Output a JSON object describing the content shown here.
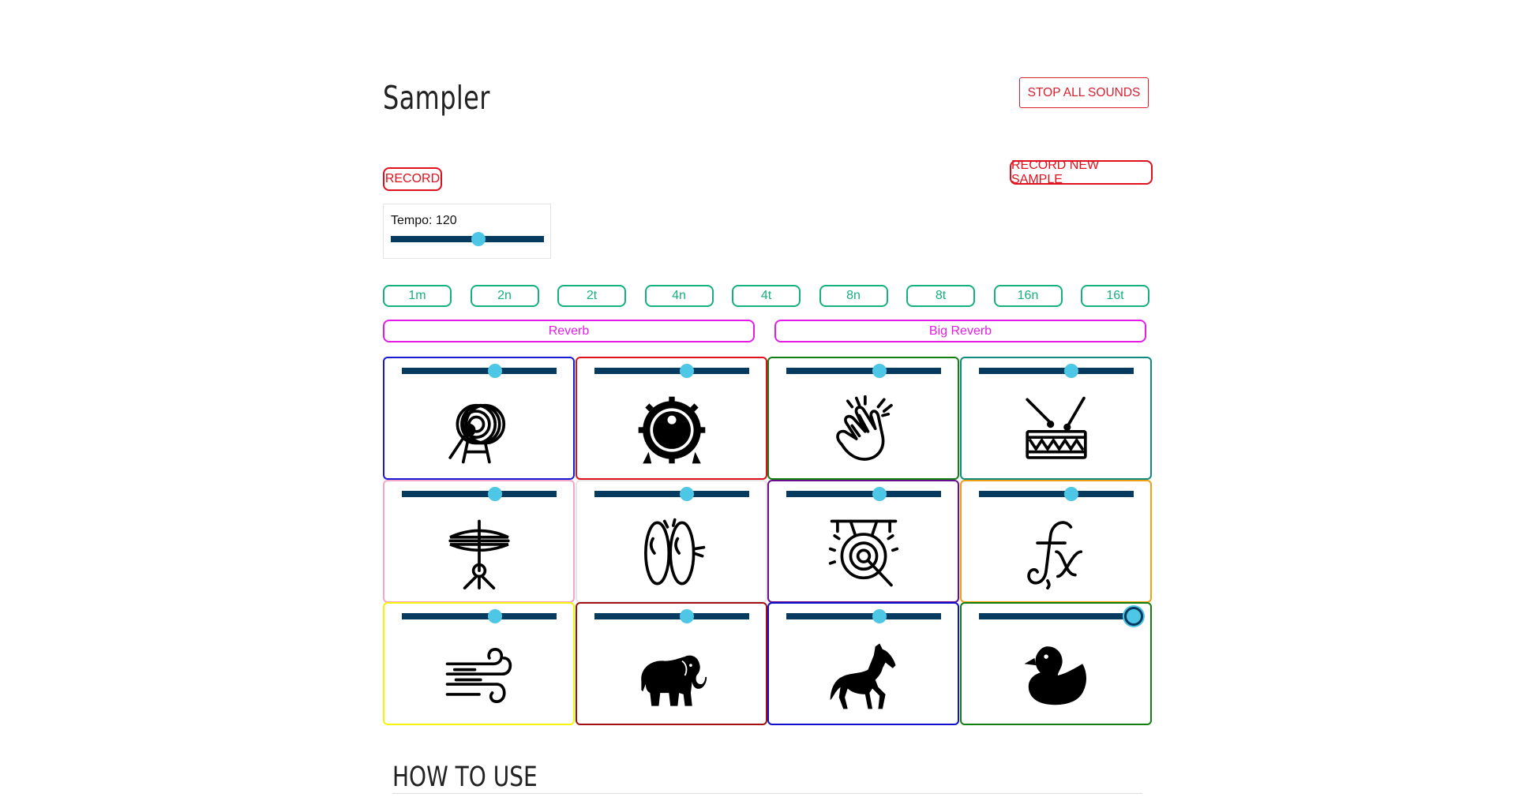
{
  "header": {
    "title": "Sampler",
    "stop_label": "STOP ALL SOUNDS"
  },
  "controls": {
    "record_label": "RECORD",
    "record_new_label": "RECORD NEW SAMPLE",
    "tempo_label": "Tempo: 120",
    "tempo_level": 0.57
  },
  "notes": [
    "1m",
    "2n",
    "2t",
    "4n",
    "4t",
    "8n",
    "8t",
    "16n",
    "16t"
  ],
  "effects": [
    "Reverb",
    "Big Reverb"
  ],
  "colors": {
    "accent_red": "#e0101d",
    "note_green": "#15b07c",
    "effect_magenta": "#e61ce6",
    "slider_track": "#063a5e",
    "slider_thumb": "#4ec7e6"
  },
  "pads": [
    {
      "icon": "bass-drum-icon",
      "border": "#1a1ad6",
      "volume": 0.6
    },
    {
      "icon": "drum-head-icon",
      "border": "#e0101d",
      "volume": 0.6
    },
    {
      "icon": "clap-icon",
      "border": "#118011",
      "volume": 0.6
    },
    {
      "icon": "snare-drum-icon",
      "border": "#0e8a80",
      "volume": 0.6
    },
    {
      "icon": "hi-hat-icon",
      "border": "#f6a5c8",
      "volume": 0.6
    },
    {
      "icon": "cymbals-icon",
      "border": "#e6e6e6",
      "volume": 0.6
    },
    {
      "icon": "gong-icon",
      "border": "#6a0d91",
      "volume": 0.6
    },
    {
      "icon": "fx-icon",
      "border": "#f0a010",
      "volume": 0.6
    },
    {
      "icon": "wind-icon",
      "border": "#f5f50a",
      "volume": 0.6
    },
    {
      "icon": "elephant-icon",
      "border": "#a01010",
      "volume": 0.6
    },
    {
      "icon": "horse-icon",
      "border": "#1010c8",
      "volume": 0.6
    },
    {
      "icon": "duck-icon",
      "border": "#118011",
      "volume": 1.0
    }
  ],
  "section": {
    "howto_title": "HOW TO USE"
  }
}
